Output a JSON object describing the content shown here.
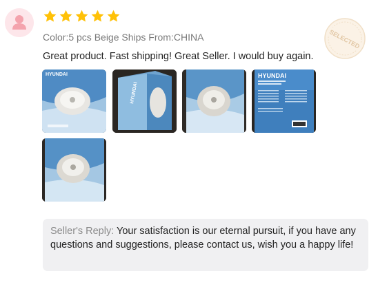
{
  "review": {
    "avatar_icon": "user-avatar-icon",
    "rating": 5,
    "rating_max": 5,
    "star_color": "#ffc107",
    "selected_stamp_text": "SELECTED",
    "variant_text": "Color:5 pcs Beige Ships From:CHINA",
    "body_text": "Great product. Fast shipping! Great Seller. I would buy again.",
    "photos": [
      {
        "brand_text": "HYUNDAI"
      },
      {
        "brand_text": "HYUNDAI"
      },
      {
        "brand_text": ""
      },
      {
        "brand_text": "HYUNDAI"
      },
      {
        "brand_text": ""
      }
    ]
  },
  "reply": {
    "label": "Seller's Reply:",
    "text": " Your satisfaction is our eternal pursuit, if you have any questions and suggestions, please contact us, wish you a happy life!"
  }
}
